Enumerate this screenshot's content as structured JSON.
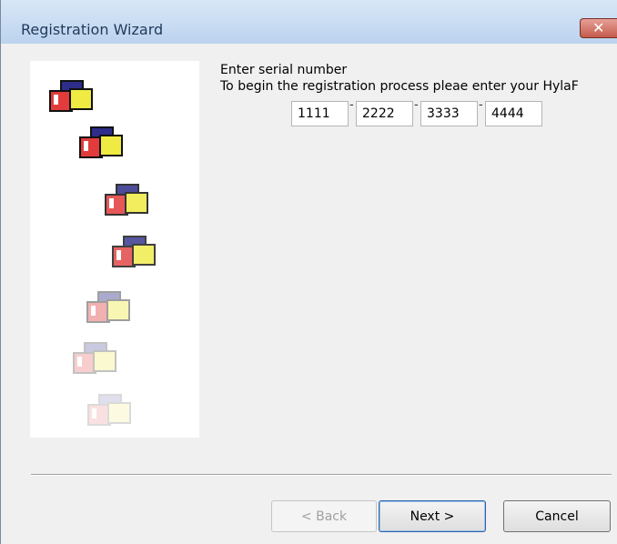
{
  "window": {
    "title": "Registration Wizard",
    "close_icon": "close-icon"
  },
  "content": {
    "heading": "Enter serial number",
    "description": "To begin the registration process pleae enter your HylaF",
    "serial_fields": [
      "1111",
      "2222",
      "3333",
      "4444"
    ],
    "separator": "-"
  },
  "buttons": {
    "back": "< Back",
    "next": "Next >",
    "cancel": "Cancel"
  },
  "colors": {
    "titlebar": "#c9dcf2",
    "close_button": "#c75a4a",
    "wizard_red": "#e23b3b",
    "wizard_blue": "#2d2d8a",
    "wizard_yellow": "#efeb43"
  }
}
